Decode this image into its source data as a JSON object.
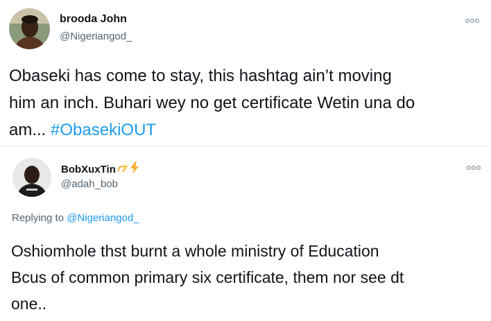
{
  "tweets": [
    {
      "display_name": "brooda John",
      "handle": "@Nigeriangod_",
      "text_lines": [
        "Obaseki has come to stay, this hashtag ain’t moving",
        "him an inch. Buhari wey no get certificate Wetin una do",
        "am... "
      ],
      "hashtag": "#ObasekiOUT",
      "avatar_icon": "user-avatar-photo",
      "more_icon": "more-options-icon"
    },
    {
      "display_name": "BobXuxTin",
      "name_emojis": [
        "dizzy-emoji",
        "lightning-emoji"
      ],
      "handle": "@adah_bob",
      "replying_prefix": "Replying to ",
      "replying_mention": "@Nigeriangod_",
      "text_lines": [
        "Oshiomhole thst burnt a whole ministry of Education",
        "Bcus of common primary six certificate, them nor see dt",
        "one.."
      ],
      "avatar_icon": "user-avatar-photo",
      "more_icon": "more-options-icon"
    }
  ],
  "colors": {
    "link": "#1d9bf0",
    "secondary_text": "#536471",
    "primary_text": "#0f1419"
  }
}
